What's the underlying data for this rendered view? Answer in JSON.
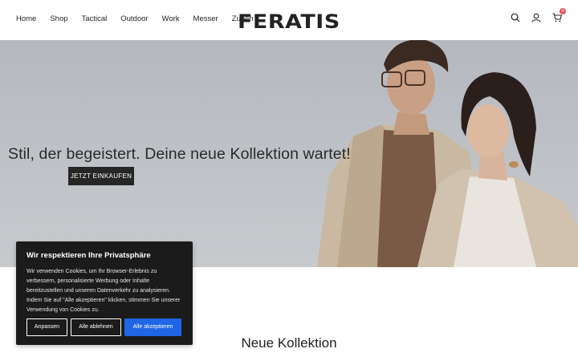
{
  "header": {
    "logo": "FERATIS",
    "nav": [
      "Home",
      "Shop",
      "Tactical",
      "Outdoor",
      "Work",
      "Messer",
      "Zubeh"
    ],
    "icons": [
      "search-icon",
      "user-icon",
      "cart-icon"
    ],
    "cart_count": "0"
  },
  "hero": {
    "title": "Stil, der begeistert. Deine neue Kollektion wartet!",
    "button_label": "JETZT EINKAUFEN"
  },
  "section": {
    "title": "Neue Kollektion"
  },
  "cookie": {
    "title": "Wir respektieren Ihre Privatsphäre",
    "text": "Wir verwenden Cookies, um Ihr Browser-Erlebnis zu verbessern, personalisierte Werbung oder Inhalte bereitzustellen und unseren Datenverkehr zu analysieren. Indem Sie auf \"Alle akzeptieren\" klicken, stimmen Sie unserer Verwendung von Cookies zu.",
    "btn_customize": "Anpassen",
    "btn_reject": "Alle ablehnen",
    "btn_accept": "Alle akzeptieren"
  },
  "colors": {
    "accent": "#1f66e5",
    "badge": "#e0565b",
    "dark": "#1b1b1b"
  }
}
